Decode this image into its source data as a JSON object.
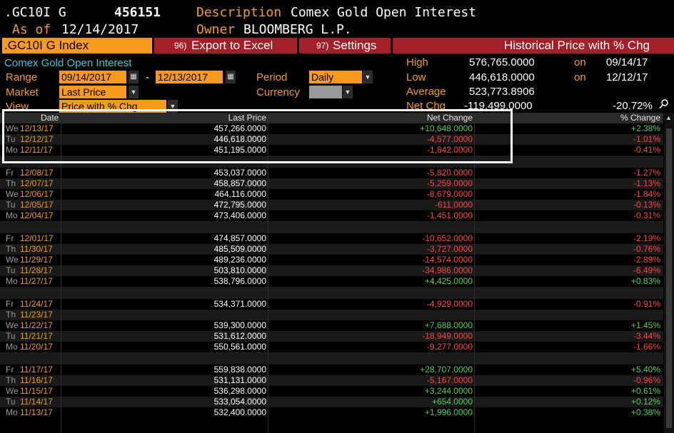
{
  "header": {
    "ticker": ".GC10I G",
    "code": "456151",
    "description_label": "Description",
    "description_value": "Comex Gold Open Interest",
    "asof_label": "As of",
    "asof_value": "12/14/2017",
    "owner_label": "Owner",
    "owner_value": "BLOOMBERG L.P."
  },
  "menu": {
    "index_label": ".GC10I G Index",
    "export_num": "96)",
    "export_label": "Export to Excel",
    "settings_num": "97)",
    "settings_label": "Settings",
    "title": "Historical Price with % Chg"
  },
  "params": {
    "security_desc": "Comex Gold Open Interest",
    "range_label": "Range",
    "range_from": "09/14/2017",
    "range_sep": "-",
    "range_to": "12/13/2017",
    "period_label": "Period",
    "period_value": "Daily",
    "market_label": "Market",
    "market_value": "Last Price",
    "currency_label": "Currency",
    "view_label": "View",
    "view_value": "Price with % Chg"
  },
  "stats": {
    "high_label": "High",
    "high_value": "576,765.0000",
    "high_on": "on",
    "high_date": "09/14/17",
    "low_label": "Low",
    "low_value": "446,618.0000",
    "low_on": "on",
    "low_date": "12/12/17",
    "avg_label": "Average",
    "avg_value": "523,773.8906",
    "netchg_label": "Net Chg",
    "netchg_value": "-119,499.0000",
    "netchg_pct": "-20.72%"
  },
  "table": {
    "col_date": "Date",
    "col_last": "Last Price",
    "col_net": "Net Change",
    "col_pct": "% Change",
    "rows": [
      {
        "day": "We",
        "date": "12/13/17",
        "last": "457,266.0000",
        "net": "+10,648.0000",
        "pct": "+2.38%",
        "sign": "pos"
      },
      {
        "day": "Tu",
        "date": "12/12/17",
        "last": "446,618.0000",
        "net": "-4,577.0000",
        "pct": "-1.01%",
        "sign": "neg"
      },
      {
        "day": "Mo",
        "date": "12/11/17",
        "last": "451,195.0000",
        "net": "-1,842.0000",
        "pct": "-0.41%",
        "sign": "neg"
      },
      {
        "gap": true
      },
      {
        "day": "Fr",
        "date": "12/08/17",
        "last": "453,037.0000",
        "net": "-5,820.0000",
        "pct": "-1.27%",
        "sign": "neg"
      },
      {
        "day": "Th",
        "date": "12/07/17",
        "last": "458,857.0000",
        "net": "-5,259.0000",
        "pct": "-1.13%",
        "sign": "neg"
      },
      {
        "day": "We",
        "date": "12/06/17",
        "last": "464,116.0000",
        "net": "-8,679.0000",
        "pct": "-1.84%",
        "sign": "neg"
      },
      {
        "day": "Tu",
        "date": "12/05/17",
        "last": "472,795.0000",
        "net": "-611.0000",
        "pct": "-0.13%",
        "sign": "neg"
      },
      {
        "day": "Mo",
        "date": "12/04/17",
        "last": "473,406.0000",
        "net": "-1,451.0000",
        "pct": "-0.31%",
        "sign": "neg"
      },
      {
        "gap": true
      },
      {
        "day": "Fr",
        "date": "12/01/17",
        "last": "474,857.0000",
        "net": "-10,652.0000",
        "pct": "-2.19%",
        "sign": "neg"
      },
      {
        "day": "Th",
        "date": "11/30/17",
        "last": "485,509.0000",
        "net": "-3,727.0000",
        "pct": "-0.76%",
        "sign": "neg"
      },
      {
        "day": "We",
        "date": "11/29/17",
        "last": "489,236.0000",
        "net": "-14,574.0000",
        "pct": "-2.89%",
        "sign": "neg"
      },
      {
        "day": "Tu",
        "date": "11/28/17",
        "last": "503,810.0000",
        "net": "-34,986.0000",
        "pct": "-6.49%",
        "sign": "neg"
      },
      {
        "day": "Mo",
        "date": "11/27/17",
        "last": "538,796.0000",
        "net": "+4,425.0000",
        "pct": "+0.83%",
        "sign": "pos"
      },
      {
        "gap": true
      },
      {
        "day": "Fr",
        "date": "11/24/17",
        "last": "534,371.0000",
        "net": "-4,929.0000",
        "pct": "-0.91%",
        "sign": "neg"
      },
      {
        "day": "Th",
        "date": "11/23/17",
        "last": "",
        "net": "",
        "pct": "",
        "sign": "neg"
      },
      {
        "day": "We",
        "date": "11/22/17",
        "last": "539,300.0000",
        "net": "+7,688.0000",
        "pct": "+1.45%",
        "sign": "pos"
      },
      {
        "day": "Tu",
        "date": "11/21/17",
        "last": "531,612.0000",
        "net": "-18,949.0000",
        "pct": "-3.44%",
        "sign": "neg"
      },
      {
        "day": "Mo",
        "date": "11/20/17",
        "last": "550,561.0000",
        "net": "-9,277.0000",
        "pct": "-1.66%",
        "sign": "neg"
      },
      {
        "gap": true
      },
      {
        "day": "Fr",
        "date": "11/17/17",
        "last": "559,838.0000",
        "net": "+28,707.0000",
        "pct": "+5.40%",
        "sign": "pos"
      },
      {
        "day": "Th",
        "date": "11/16/17",
        "last": "531,131.0000",
        "net": "-5,167.0000",
        "pct": "-0.96%",
        "sign": "neg"
      },
      {
        "day": "We",
        "date": "11/15/17",
        "last": "536,298.0000",
        "net": "+3,244.0000",
        "pct": "+0.61%",
        "sign": "pos"
      },
      {
        "day": "Tu",
        "date": "11/14/17",
        "last": "533,054.0000",
        "net": "+654.0000",
        "pct": "+0.12%",
        "sign": "pos"
      },
      {
        "day": "Mo",
        "date": "11/13/17",
        "last": "532,400.0000",
        "net": "+1,996.0000",
        "pct": "+0.38%",
        "sign": "pos"
      }
    ]
  },
  "colors": {
    "accent_orange": "#f79a1e",
    "menu_red": "#a21f2a",
    "positive": "#4fd15c",
    "negative": "#ff4444"
  },
  "icons": {
    "calendar": "calendar-icon",
    "dropdown": "chevron-down-icon",
    "search": "search-icon"
  }
}
